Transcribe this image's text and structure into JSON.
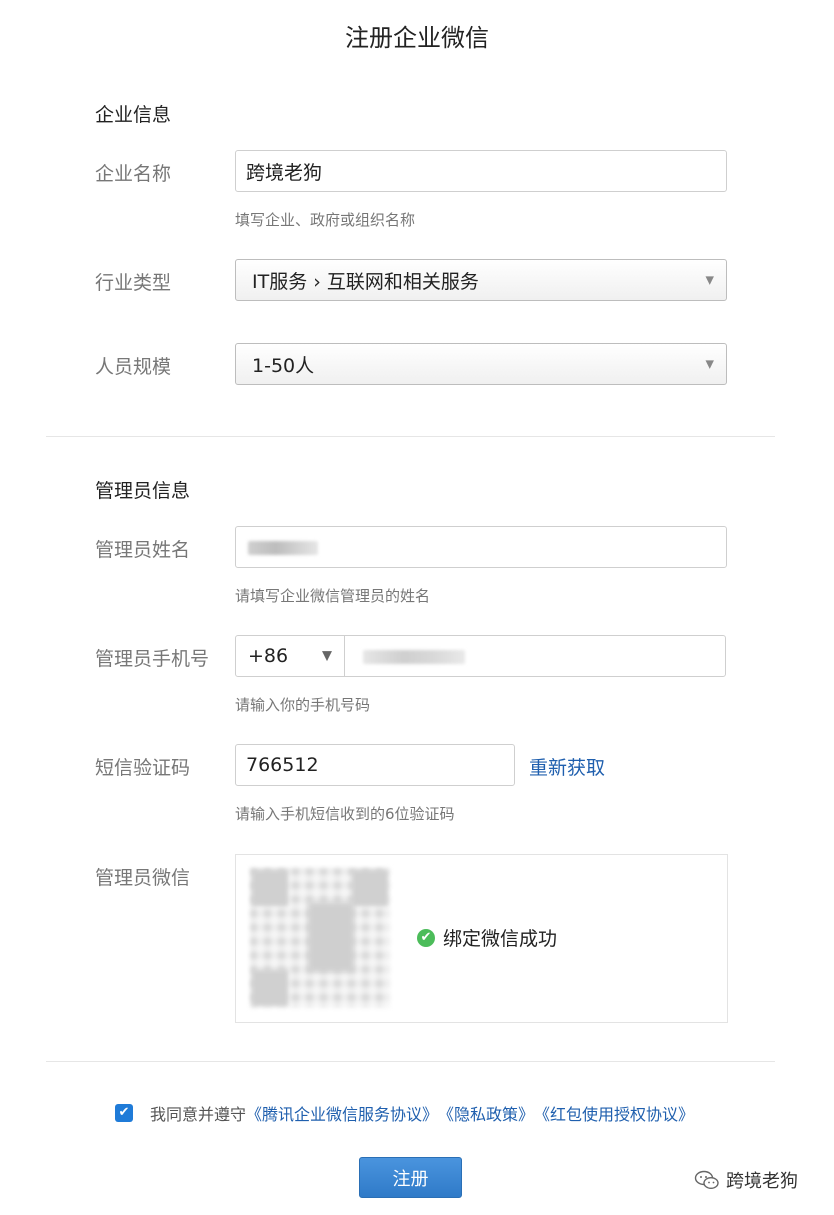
{
  "page": {
    "title": "注册企业微信"
  },
  "company_section": {
    "title": "企业信息",
    "name_label": "企业名称",
    "name_value": "跨境老狗",
    "name_hint": "填写企业、政府或组织名称",
    "industry_label": "行业类型",
    "industry_value": "IT服务 › 互联网和相关服务",
    "size_label": "人员规模",
    "size_value": "1-50人"
  },
  "admin_section": {
    "title": "管理员信息",
    "name_label": "管理员姓名",
    "name_hint": "请填写企业微信管理员的姓名",
    "phone_label": "管理员手机号",
    "country_code": "+86",
    "phone_hint": "请输入你的手机号码",
    "sms_label": "短信验证码",
    "sms_value": "766512",
    "resend_label": "重新获取",
    "sms_hint": "请输入手机短信收到的6位验证码",
    "wechat_label": "管理员微信",
    "bind_status": "绑定微信成功"
  },
  "agreement": {
    "prefix": "我同意并遵守",
    "links": [
      "《腾讯企业微信服务协议》",
      "《隐私政策》",
      "《红包使用授权协议》"
    ],
    "checked": true
  },
  "submit_label": "注册",
  "watermark": "跨境老狗",
  "colors": {
    "primary_button": "#2f7ac8",
    "link": "#1f5fae",
    "success": "#4cbc5a"
  }
}
